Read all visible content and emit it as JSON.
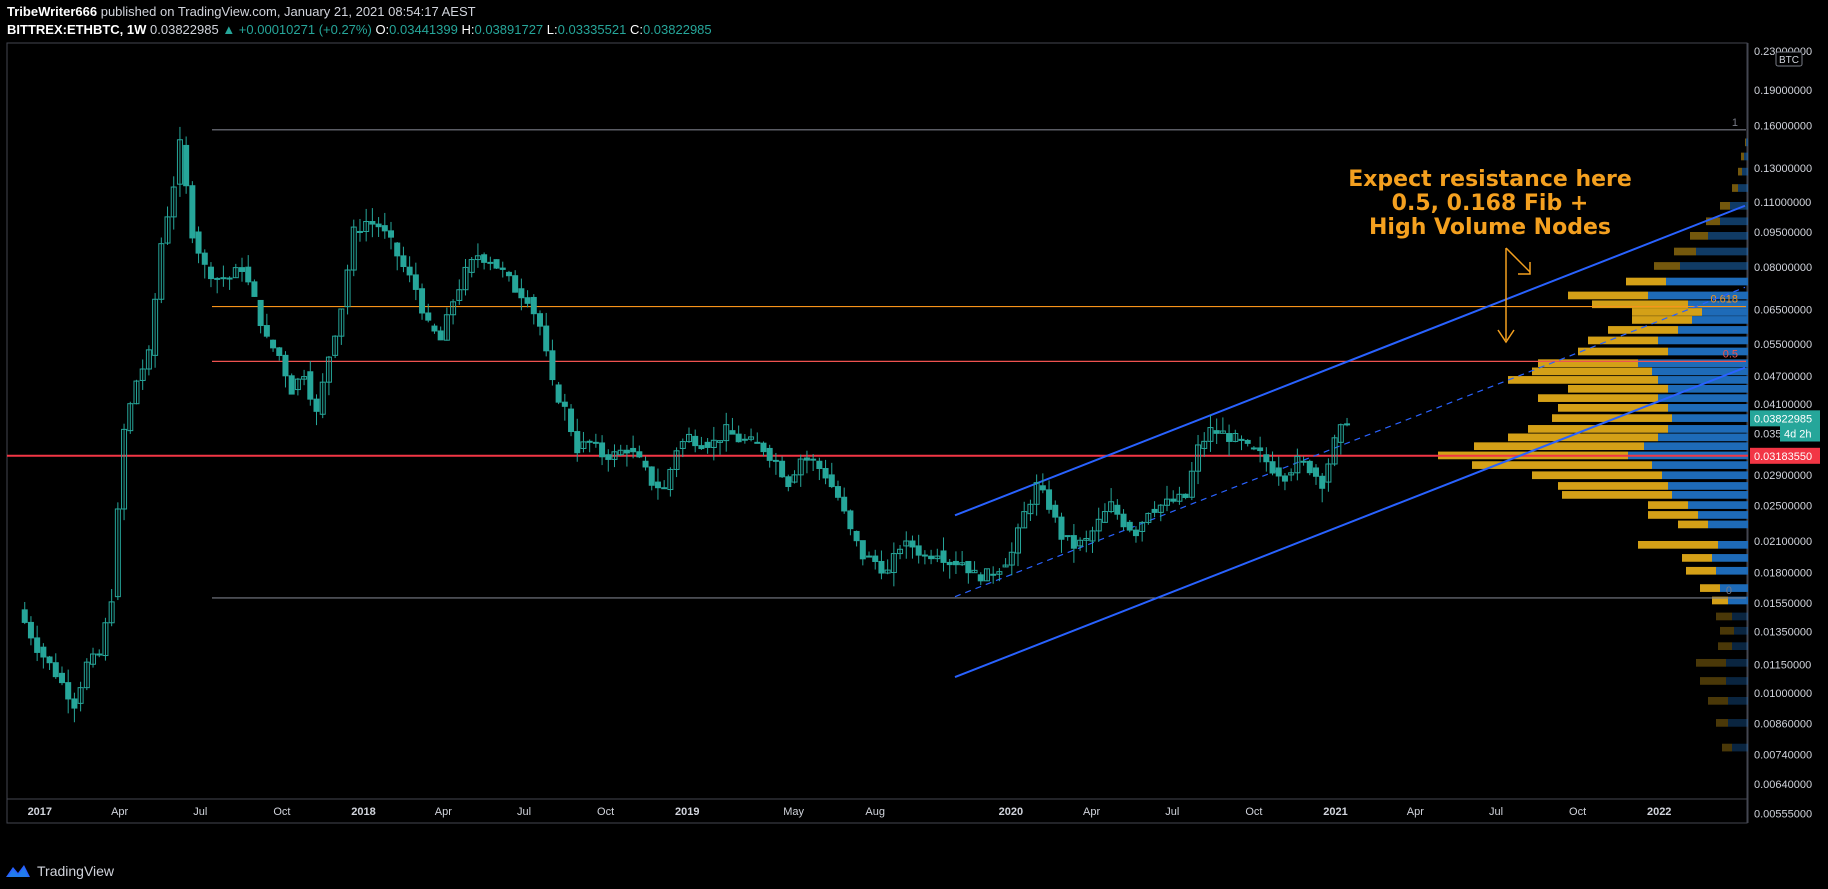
{
  "header": {
    "author": "TribeWriter666",
    "published": "published on TradingView.com, January 21, 2021 08:54:17 AEST"
  },
  "symbol_line": {
    "symbol": "BITTREX:ETHBTC, 1W",
    "last": "0.03822985",
    "change": "▲ +0.00010271 (+0.27%)",
    "o_label": "O:",
    "o_value": "0.03441399",
    "h_label": "H:",
    "h_value": "0.03891727",
    "l_label": "L:",
    "l_value": "0.03335521",
    "c_label": "C:",
    "c_value": "0.03822985"
  },
  "annotation": {
    "line1": "Expect resistance here",
    "line2": "0.5, 0.168 Fib +",
    "line3": "High Volume Nodes"
  },
  "footer": {
    "brand": "TradingView",
    "logo_icon": "tradingview-logo-icon"
  },
  "colors": {
    "candle": "#26a69a",
    "channel": "#2962ff",
    "annotation": "#f4a01f",
    "fib_0618": "#f7931a",
    "fib_05": "#ef5350",
    "fib_range": "#787b86",
    "support": "#f23645",
    "vp_up": "#1e6bb8",
    "vp_down": "#d4a017"
  },
  "chart_data": {
    "type": "candlestick",
    "y_axis_currency": "BTC",
    "y_scale": "log",
    "ylim": [
      0.0054,
      0.2
    ],
    "y_ticks": [
      "0.23000000",
      "0.19000000",
      "0.16000000",
      "0.13000000",
      "0.11000000",
      "0.09500000",
      "0.08000000",
      "0.06500000",
      "0.05500000",
      "0.04700000",
      "0.04100000",
      "0.035",
      "0.02900000",
      "0.02500000",
      "0.02100000",
      "0.01800000",
      "0.01550000",
      "0.01350000",
      "0.01150000",
      "0.01000000",
      "0.00860000",
      "0.00740000",
      "0.00640000",
      "0.00555000"
    ],
    "x_ticks": [
      "2017",
      "Apr",
      "Jul",
      "Oct",
      "2018",
      "Apr",
      "Jul",
      "Oct",
      "2019",
      "May",
      "Aug",
      "2020",
      "Apr",
      "Jul",
      "Oct",
      "2021",
      "Apr",
      "Jul",
      "Oct",
      "2022"
    ],
    "price_badges": [
      {
        "label": "0.03822985",
        "value": 0.03822985,
        "color": "#26a69a"
      },
      {
        "label": "4d 2h",
        "value": 0.0355,
        "color": "#26a69a"
      },
      {
        "label": "0.03183550",
        "value": 0.0318355,
        "color": "#f23645"
      }
    ],
    "fib_levels": [
      {
        "label": "1",
        "value": 0.1565
      },
      {
        "label": "0.618",
        "value": 0.066
      },
      {
        "label": "0.5",
        "value": 0.0505
      },
      {
        "label": "0",
        "value": 0.0159
      }
    ],
    "support_line": 0.0318355,
    "channel": {
      "upper": [
        [
          0.0238,
          0.0238
        ],
        [
          1.0,
          0.108
        ]
      ],
      "lower": [
        [
          0.0108,
          0.0108
        ],
        [
          1.0,
          0.049
        ]
      ],
      "mid": [
        [
          0.016,
          0.016
        ],
        [
          1.0,
          0.0725
        ]
      ]
    },
    "weekly_close_path": [
      [
        "2016-12-15",
        0.015
      ],
      [
        "2017-01-05",
        0.0125
      ],
      [
        "2017-01-26",
        0.011
      ],
      [
        "2017-02-16",
        0.0095
      ],
      [
        "2017-03-02",
        0.0115
      ],
      [
        "2017-03-16",
        0.012
      ],
      [
        "2017-03-30",
        0.016
      ],
      [
        "2017-04-13",
        0.036
      ],
      [
        "2017-04-27",
        0.046
      ],
      [
        "2017-05-11",
        0.052
      ],
      [
        "2017-05-25",
        0.09
      ],
      [
        "2017-06-08",
        0.12
      ],
      [
        "2017-06-15",
        0.145
      ],
      [
        "2017-06-29",
        0.095
      ],
      [
        "2017-07-13",
        0.08
      ],
      [
        "2017-07-27",
        0.076
      ],
      [
        "2017-08-10",
        0.076
      ],
      [
        "2017-08-24",
        0.08
      ],
      [
        "2017-09-07",
        0.068
      ],
      [
        "2017-09-21",
        0.056
      ],
      [
        "2017-10-05",
        0.052
      ],
      [
        "2017-10-19",
        0.044
      ],
      [
        "2017-11-02",
        0.048
      ],
      [
        "2017-11-16",
        0.039
      ],
      [
        "2017-11-30",
        0.052
      ],
      [
        "2017-12-14",
        0.066
      ],
      [
        "2017-12-28",
        0.095
      ],
      [
        "2018-01-11",
        0.1
      ],
      [
        "2018-01-25",
        0.098
      ],
      [
        "2018-02-08",
        0.09
      ],
      [
        "2018-02-22",
        0.08
      ],
      [
        "2018-03-08",
        0.072
      ],
      [
        "2018-03-22",
        0.06
      ],
      [
        "2018-04-05",
        0.056
      ],
      [
        "2018-04-19",
        0.068
      ],
      [
        "2018-05-03",
        0.078
      ],
      [
        "2018-05-17",
        0.085
      ],
      [
        "2018-05-31",
        0.083
      ],
      [
        "2018-06-14",
        0.078
      ],
      [
        "2018-06-28",
        0.072
      ],
      [
        "2018-07-12",
        0.069
      ],
      [
        "2018-07-26",
        0.06
      ],
      [
        "2018-08-09",
        0.045
      ],
      [
        "2018-08-23",
        0.04
      ],
      [
        "2018-09-06",
        0.033
      ],
      [
        "2018-09-20",
        0.034
      ],
      [
        "2018-10-04",
        0.032
      ],
      [
        "2018-10-18",
        0.032
      ],
      [
        "2018-11-01",
        0.033
      ],
      [
        "2018-11-15",
        0.031
      ],
      [
        "2018-11-29",
        0.028
      ],
      [
        "2018-12-13",
        0.027
      ],
      [
        "2018-12-27",
        0.033
      ],
      [
        "2019-01-10",
        0.035
      ],
      [
        "2019-01-24",
        0.034
      ],
      [
        "2019-02-07",
        0.034
      ],
      [
        "2019-02-21",
        0.036
      ],
      [
        "2019-03-07",
        0.0345
      ],
      [
        "2019-03-21",
        0.034
      ],
      [
        "2019-04-04",
        0.033
      ],
      [
        "2019-04-18",
        0.031
      ],
      [
        "2019-05-02",
        0.028
      ],
      [
        "2019-05-16",
        0.0315
      ],
      [
        "2019-05-30",
        0.031
      ],
      [
        "2019-06-13",
        0.029
      ],
      [
        "2019-06-27",
        0.026
      ],
      [
        "2019-07-11",
        0.022
      ],
      [
        "2019-07-25",
        0.0195
      ],
      [
        "2019-08-08",
        0.019
      ],
      [
        "2019-08-22",
        0.018
      ],
      [
        "2019-09-05",
        0.0205
      ],
      [
        "2019-09-19",
        0.0205
      ],
      [
        "2019-10-03",
        0.0195
      ],
      [
        "2019-10-17",
        0.02
      ],
      [
        "2019-10-31",
        0.019
      ],
      [
        "2019-11-14",
        0.019
      ],
      [
        "2019-11-28",
        0.0178
      ],
      [
        "2019-12-12",
        0.0178
      ],
      [
        "2019-12-26",
        0.0185
      ],
      [
        "2020-01-09",
        0.0198
      ],
      [
        "2020-01-23",
        0.024
      ],
      [
        "2020-02-06",
        0.0275
      ],
      [
        "2020-02-20",
        0.025
      ],
      [
        "2020-03-05",
        0.0215
      ],
      [
        "2020-03-19",
        0.0205
      ],
      [
        "2020-04-02",
        0.021
      ],
      [
        "2020-04-16",
        0.023
      ],
      [
        "2020-04-30",
        0.025
      ],
      [
        "2020-05-14",
        0.023
      ],
      [
        "2020-05-28",
        0.022
      ],
      [
        "2020-06-11",
        0.0245
      ],
      [
        "2020-06-25",
        0.025
      ],
      [
        "2020-07-09",
        0.0255
      ],
      [
        "2020-07-23",
        0.026
      ],
      [
        "2020-08-06",
        0.033
      ],
      [
        "2020-08-20",
        0.036
      ],
      [
        "2020-09-03",
        0.0355
      ],
      [
        "2020-09-17",
        0.0345
      ],
      [
        "2020-10-01",
        0.033
      ],
      [
        "2020-10-15",
        0.032
      ],
      [
        "2020-10-29",
        0.03
      ],
      [
        "2020-11-12",
        0.029
      ],
      [
        "2020-11-26",
        0.031
      ],
      [
        "2020-12-10",
        0.03
      ],
      [
        "2020-12-24",
        0.028
      ],
      [
        "2021-01-07",
        0.034
      ],
      [
        "2021-01-21",
        0.0382
      ]
    ]
  }
}
